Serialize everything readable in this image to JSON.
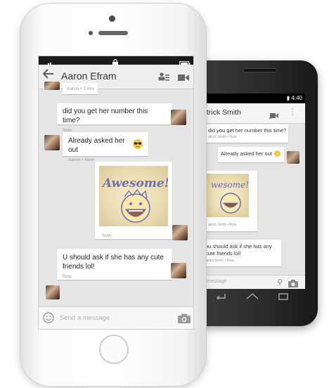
{
  "android": {
    "status_time": "4:40",
    "header_title": "atrick Smith",
    "messages": [
      {
        "text": "did you get her number this time?",
        "meta": "atrick Smith • Now"
      },
      {
        "text": "Already asked her out",
        "meta": ""
      },
      {
        "meta": "atrick Smith • Now"
      },
      {
        "text": "ou should ask if she has any cute friends lol!",
        "meta": "atrick Smith • Now"
      }
    ],
    "input_placeholder": "message"
  },
  "iphone": {
    "header_title": "Aaron Efram",
    "messages": [
      {
        "meta": "Aaron • 1 min"
      },
      {
        "text": "did you get her number this time?",
        "meta": "Now"
      },
      {
        "text": "Already asked her out",
        "meta": "Aaron • Now"
      },
      {
        "sticker_text": "Awesome!",
        "meta": "Now"
      },
      {
        "text": "U should ask if she has any cute friends lol!",
        "meta": "Now"
      }
    ],
    "input_placeholder": "Send a message"
  }
}
